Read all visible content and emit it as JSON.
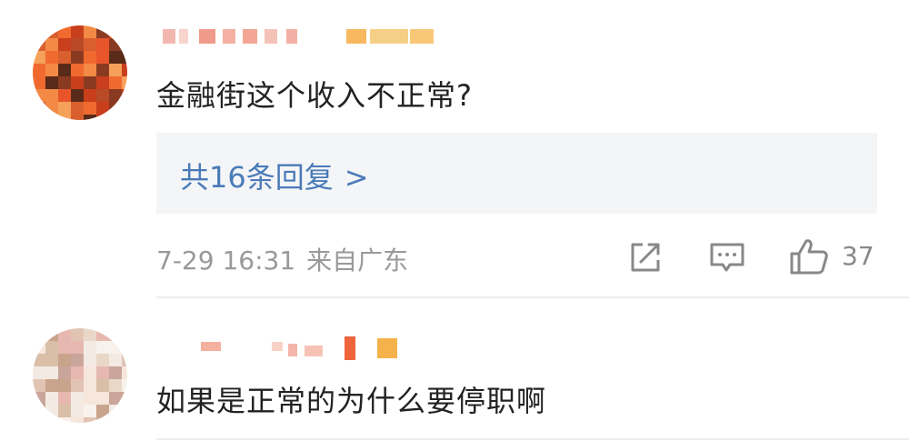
{
  "comments": [
    {
      "username": "",
      "text": "金融街这个收入不正常?",
      "replies_label": "共16条回复",
      "replies_chevron": ">",
      "date": "7-29 16:31",
      "location": "来自广东",
      "likes": "37",
      "icons": {
        "share": "share-icon",
        "reply": "comment-icon",
        "like": "thumbs-up-icon"
      }
    },
    {
      "username": "",
      "text": "如果是正常的为什么要停职啊"
    }
  ],
  "colors": {
    "link": "#4a7bb8",
    "text": "#222222",
    "meta": "#999999",
    "reply_bg": "#f4f5f7"
  }
}
